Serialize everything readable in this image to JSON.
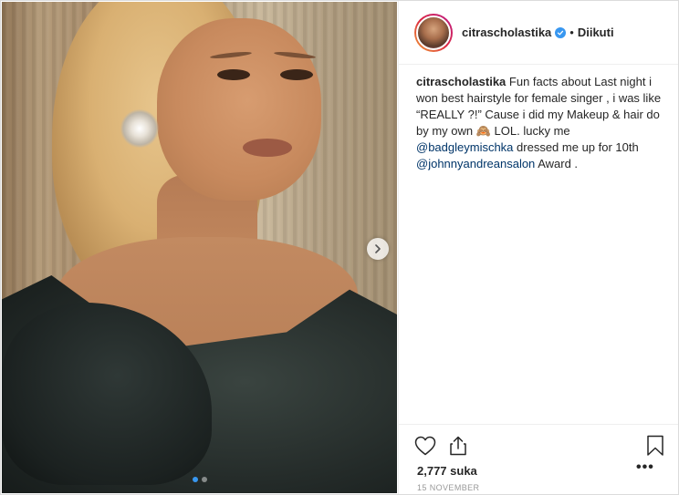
{
  "post": {
    "username": "citrascholastika",
    "separator": "•",
    "follow_status": "Diikuti",
    "caption_user": "citrascholastika",
    "caption_part1": " Fun facts about Last night i won best hairstyle for female singer , i was like “REALLY ?!” Cause i did my Makeup & hair do by my own ",
    "caption_emoji": "🙈",
    "caption_part2": " LOL. lucky me ",
    "mention1": "@badgleymischka",
    "caption_part3": " dressed me up for 10th ",
    "mention2": "@johnnyandreansalon",
    "caption_part4": " Award .",
    "likes": "2,777 suka",
    "more": "•••",
    "date": "15 NOVEMBER"
  },
  "carousel": {
    "current_slide": 1,
    "total_slides": 2
  },
  "icons": {
    "verified": "verified-badge-icon",
    "like": "heart-outline-icon",
    "share": "share-upload-icon",
    "save": "bookmark-outline-icon",
    "next": "chevron-right-icon"
  },
  "colors": {
    "accent": "#3897f0",
    "mention": "#003569",
    "muted": "#999999",
    "text": "#262626"
  }
}
